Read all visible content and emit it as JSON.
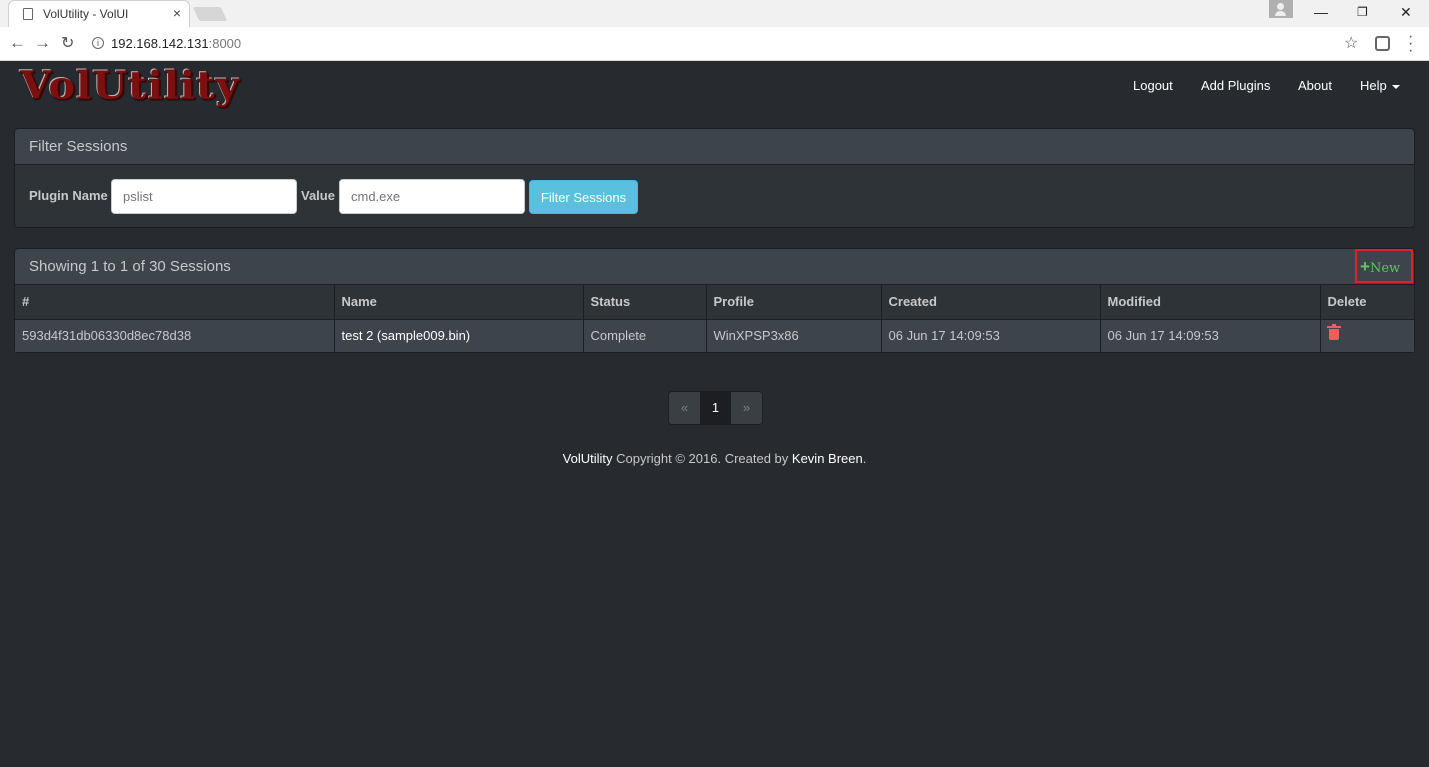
{
  "browser": {
    "tab_title": "VolUtility - VolUI",
    "tab_close": "×",
    "url_host": "192.168.142.131",
    "url_port": ":8000"
  },
  "navbar": {
    "logo": "VolUtility",
    "links": {
      "logout": "Logout",
      "add_plugins": "Add Plugins",
      "about": "About",
      "help": "Help"
    }
  },
  "filter": {
    "title": "Filter Sessions",
    "plugin_label": "Plugin Name",
    "plugin_placeholder": "pslist",
    "value_label": "Value",
    "value_placeholder": "cmd.exe",
    "button": "Filter Sessions"
  },
  "sessions": {
    "summary": "Showing 1 to 1 of 30 Sessions",
    "new_label": "New",
    "columns": [
      "#",
      "Name",
      "Status",
      "Profile",
      "Created",
      "Modified",
      "Delete"
    ],
    "rows": [
      {
        "id": "593d4f31db06330d8ec78d38",
        "name": "test 2 (sample009.bin)",
        "status": "Complete",
        "profile": "WinXPSP3x86",
        "created": "06 Jun 17 14:09:53",
        "modified": "06 Jun 17 14:09:53"
      }
    ]
  },
  "pagination": {
    "prev": "«",
    "current": "1",
    "next": "»"
  },
  "footer": {
    "app": "VolUtility",
    "text": " Copyright © 2016. Created by ",
    "author": "Kevin Breen",
    "end": "."
  },
  "colors": {
    "background": "#272b30",
    "panel_heading": "#3e444c",
    "filter_button": "#5bc0de",
    "new_button_text": "#62c462",
    "new_button_border": "#e0202a",
    "delete_icon": "#ee5f5b"
  }
}
